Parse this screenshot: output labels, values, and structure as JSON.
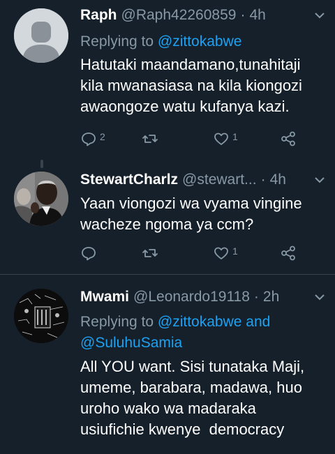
{
  "tweets": [
    {
      "name": "Raph",
      "handle": "@Raph42260859",
      "sep": "·",
      "time": "4h",
      "replying_prefix": "Replying to ",
      "replying_to": "@zittokabwe",
      "text_lines": [
        "Hatutaki maandamano,tunahitaji",
        "kila mwanasiasa na kila kiongozi",
        "awaongoze watu kufanya kazi."
      ],
      "reply_count": "2",
      "retweet_count": "",
      "like_count": "1"
    },
    {
      "name": "StewartCharlz",
      "handle": "@stewart...",
      "sep": "·",
      "time": "4h",
      "text_lines": [
        "Yaan viongozi wa vyama vingine",
        "wacheze ngoma ya ccm?"
      ],
      "reply_count": "",
      "retweet_count": "",
      "like_count": "1"
    },
    {
      "name": "Mwami",
      "handle": "@Leonardo19118",
      "sep": "·",
      "time": "2h",
      "replying_prefix": "Replying to ",
      "replying_to": "@zittokabwe",
      "replying_and": " and",
      "replying_to_2": "@SuluhuSamia",
      "text_lines": [
        "All YOU want. Sisi tunataka Maji,",
        "umeme, barabara, madawa, huo",
        "uroho wako wa madaraka",
        "usiufichie kwenye  democracy"
      ]
    }
  ],
  "colors": {
    "background": "#15202b",
    "secondary_text": "#8899a6",
    "link": "#1da1f2",
    "divider": "#38444d"
  },
  "icons": {
    "reply": "reply-icon",
    "retweet": "retweet-icon",
    "like": "heart-icon",
    "share": "share-icon",
    "menu": "chevron-down-icon"
  }
}
